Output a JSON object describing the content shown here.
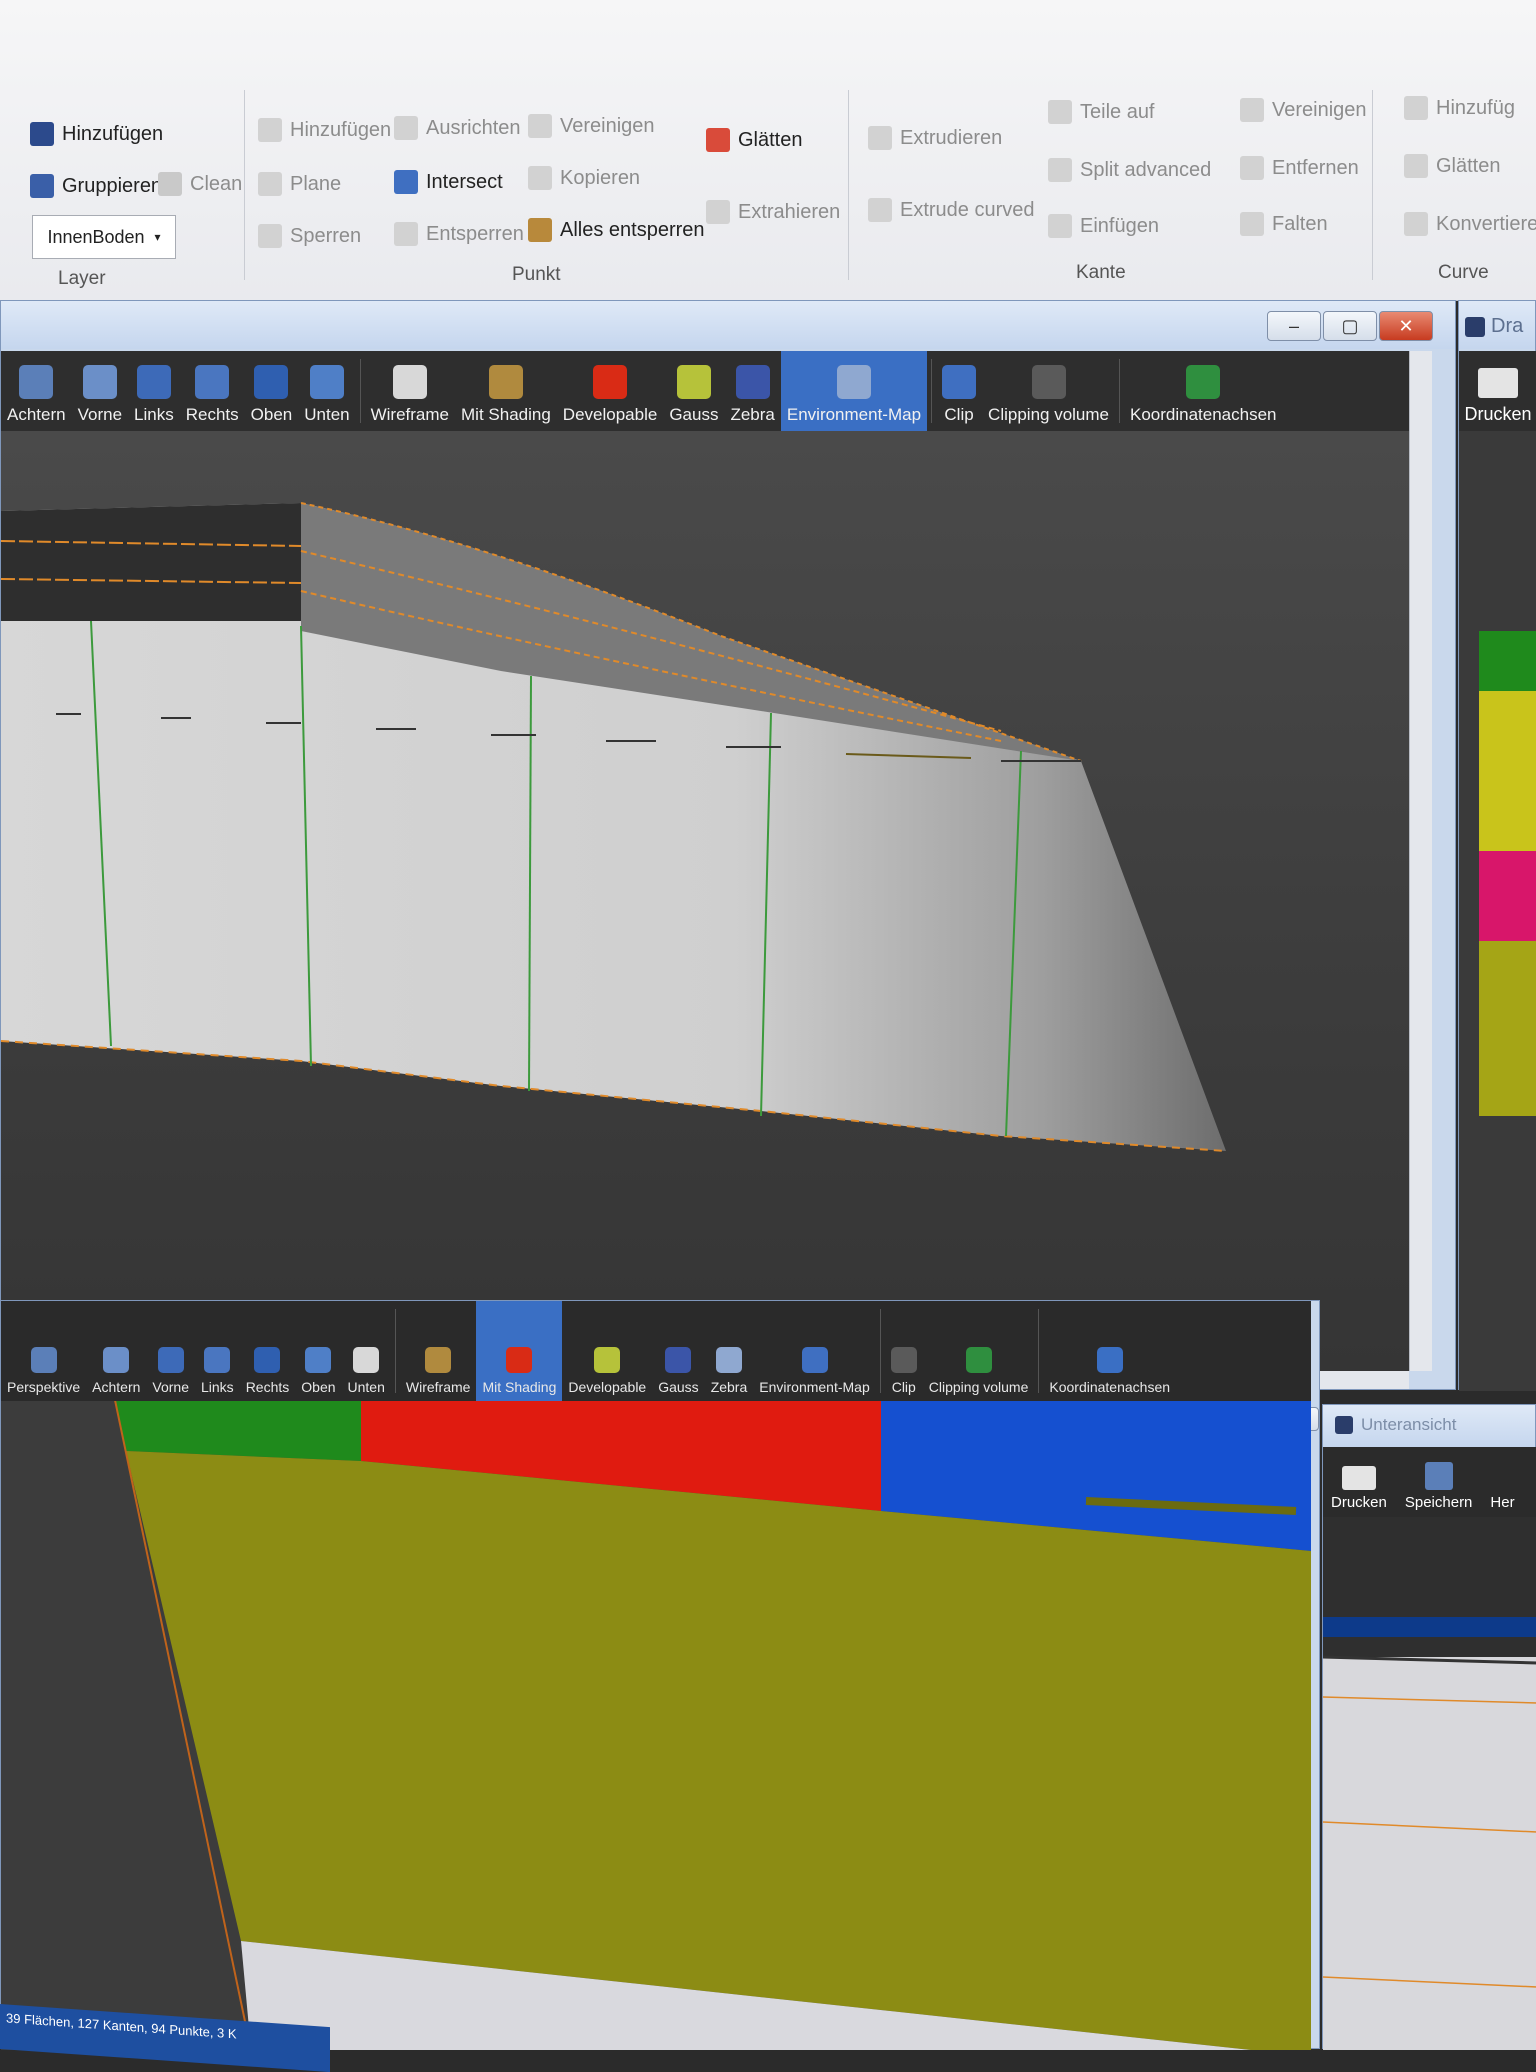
{
  "ribbon": {
    "layer": {
      "add": "Hinzufügen",
      "group": "Gruppieren",
      "clean": "Clean",
      "combo_value": "InnenBoden",
      "label": "Layer"
    },
    "punkt": {
      "add": "Hinzufügen",
      "align": "Ausrichten",
      "unite": "Vereinigen",
      "plane": "Plane",
      "intersect": "Intersect",
      "copy": "Kopieren",
      "lock": "Sperren",
      "unlock": "Entsperren",
      "unlock_all": "Alles entsperren",
      "smooth": "Glätten",
      "extract": "Extrahieren",
      "label": "Punkt"
    },
    "kante": {
      "extrude": "Extrudieren",
      "extrude_curved": "Extrude curved",
      "split": "Teile auf",
      "split_advanced": "Split advanced",
      "insert": "Einfügen",
      "unite": "Vereinigen",
      "remove": "Entfernen",
      "fold": "Falten",
      "label": "Kante"
    },
    "curve": {
      "add": "Hinzufüg",
      "smooth": "Glätten",
      "convert": "Konvertiere",
      "label": "Curve"
    }
  },
  "main_view": {
    "tools": [
      "Achtern",
      "Vorne",
      "Links",
      "Rechts",
      "Oben",
      "Unten",
      "Wireframe",
      "Mit Shading",
      "Developable",
      "Gauss",
      "Zebra",
      "Environment-Map",
      "Clip",
      "Clipping volume",
      "Koordinatenachsen"
    ],
    "active_tool": "Environment-Map"
  },
  "side_window": {
    "title": "Dra",
    "print": "Drucken"
  },
  "lower_view": {
    "tools": [
      "Perspektive",
      "Achtern",
      "Vorne",
      "Links",
      "Rechts",
      "Oben",
      "Unten",
      "Wireframe",
      "Mit Shading",
      "Developable",
      "Gauss",
      "Zebra",
      "Environment-Map",
      "Clip",
      "Clipping volume",
      "Koordinatenachsen"
    ],
    "active_tool": "Mit Shading"
  },
  "unteransicht": {
    "title": "Unteransicht",
    "print": "Drucken",
    "save": "Speichern",
    "more": "Her"
  },
  "status": {
    "text": "39 Flächen, 127 Kanten, 94 Punkte, 3 K"
  },
  "colors": {
    "accent": "#3a6fc4",
    "green": "#1f8a1c",
    "red": "#e01b10",
    "blue": "#1550d0",
    "olive": "#8c8c14",
    "yellow": "#c9c41b",
    "magenta": "#d8166a"
  }
}
